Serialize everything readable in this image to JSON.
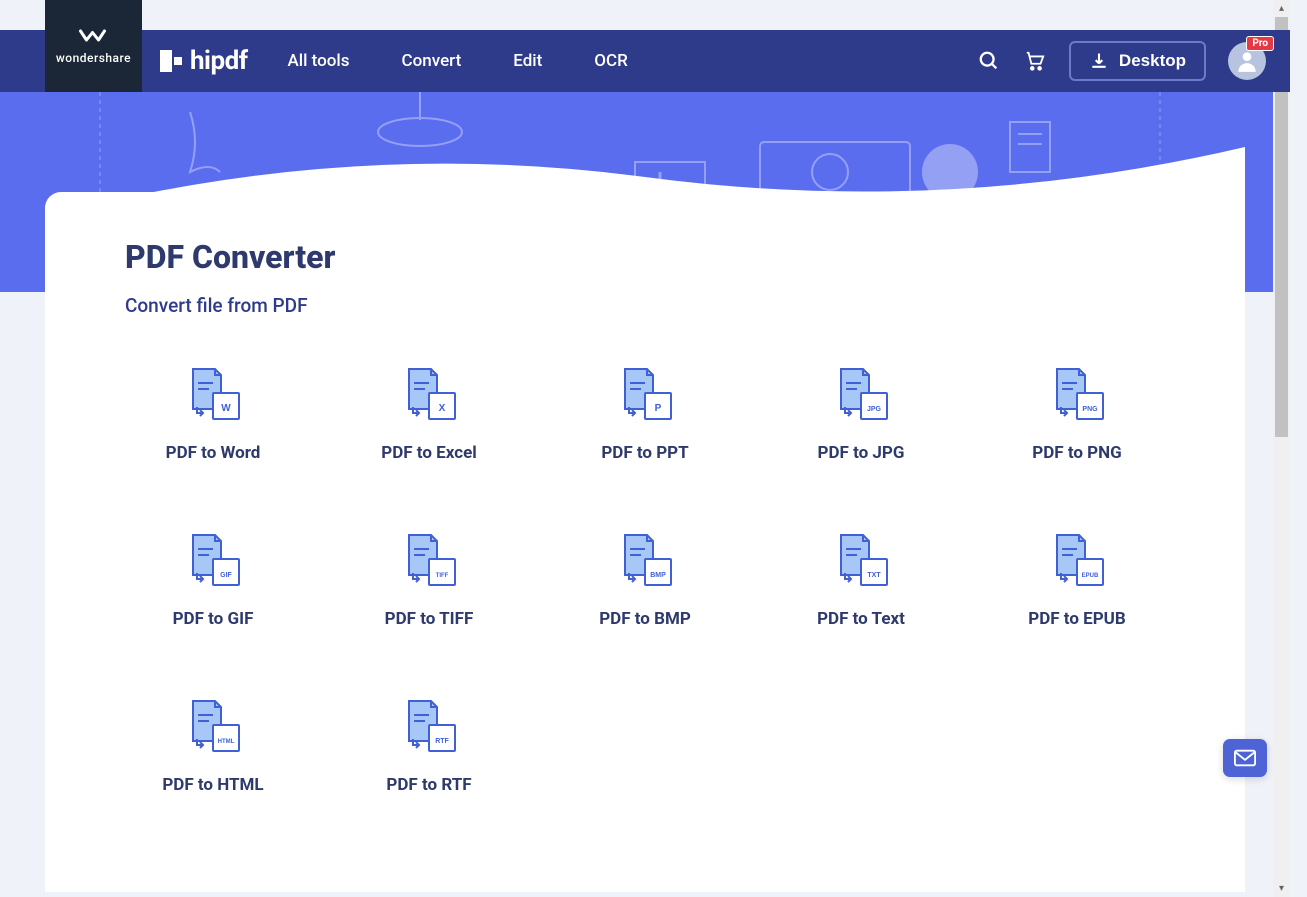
{
  "brand": {
    "parent": "wondershare",
    "product": "hipdf"
  },
  "nav": {
    "items": [
      {
        "label": "All tools"
      },
      {
        "label": "Convert"
      },
      {
        "label": "Edit"
      },
      {
        "label": "OCR"
      }
    ],
    "desktop_label": "Desktop",
    "pro_badge": "Pro"
  },
  "page": {
    "title": "PDF Converter",
    "subtitle": "Convert file from PDF"
  },
  "tools": [
    {
      "label": "PDF to Word",
      "badge": "W"
    },
    {
      "label": "PDF to Excel",
      "badge": "X"
    },
    {
      "label": "PDF to PPT",
      "badge": "P"
    },
    {
      "label": "PDF to JPG",
      "badge": "JPG"
    },
    {
      "label": "PDF to PNG",
      "badge": "PNG"
    },
    {
      "label": "PDF to GIF",
      "badge": "GIF"
    },
    {
      "label": "PDF to TIFF",
      "badge": "TIFF"
    },
    {
      "label": "PDF to BMP",
      "badge": "BMP"
    },
    {
      "label": "PDF to Text",
      "badge": "TXT"
    },
    {
      "label": "PDF to EPUB",
      "badge": "EPUB"
    },
    {
      "label": "PDF to HTML",
      "badge": "HTML"
    },
    {
      "label": "PDF to RTF",
      "badge": "RTF"
    }
  ],
  "colors": {
    "primary": "#2e3a8a",
    "accent": "#5b6def",
    "text": "#2e3a6d",
    "badge_pro": "#e53946"
  }
}
